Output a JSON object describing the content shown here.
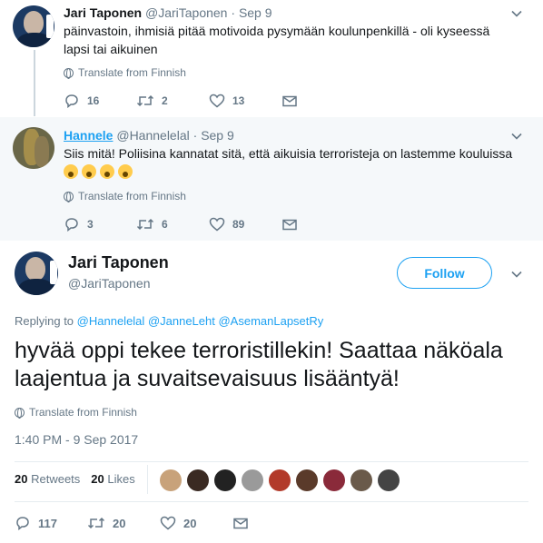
{
  "tweets": [
    {
      "name": "Jari Taponen",
      "handle": "@JariTaponen",
      "separator": "·",
      "date": "Sep 9",
      "text": "päinvastoin, ihmisiä pitää motivoida pysymään koulunpenkillä - oli kyseessä lapsi tai aikuinen",
      "translate": "Translate from Finnish",
      "replies": "16",
      "retweets": "2",
      "likes": "13"
    },
    {
      "name": "Hannele",
      "handle": "@Hannelelal",
      "separator": "·",
      "date": "Sep 9",
      "text": "Siis mitä! Poliisina kannatat sitä, että aikuisia terroristeja on lastemme kouluissa",
      "translate": "Translate from Finnish",
      "replies": "3",
      "retweets": "6",
      "likes": "89"
    }
  ],
  "main_tweet": {
    "name": "Jari Taponen",
    "handle": "@JariTaponen",
    "follow_label": "Follow",
    "replying_prefix": "Replying to",
    "mentions": [
      "@Hannelelal",
      "@JanneLeht",
      "@AsemanLapsetRy"
    ],
    "text": "hyvää oppi tekee terroristillekin! Saattaa näköala laajentua ja suvaitsevaisuus lisääntyä!",
    "translate": "Translate from Finnish",
    "timestamp": "1:40 PM - 9 Sep 2017",
    "retweets_count": "20",
    "retweets_label": "Retweets",
    "likes_count": "20",
    "likes_label": "Likes",
    "replies": "117",
    "retweets": "20",
    "likes": "20"
  },
  "liker_avatar_colors": [
    "#c8a27a",
    "#3a2a22",
    "#222222",
    "#9a9a9a",
    "#b23a2a",
    "#5a3a2a",
    "#8a2a3a",
    "#6a5a4a",
    "#444444"
  ],
  "colors": {
    "accent": "#1da1f2",
    "muted_text": "#657786",
    "highlight_background": "#f5f8fa"
  }
}
